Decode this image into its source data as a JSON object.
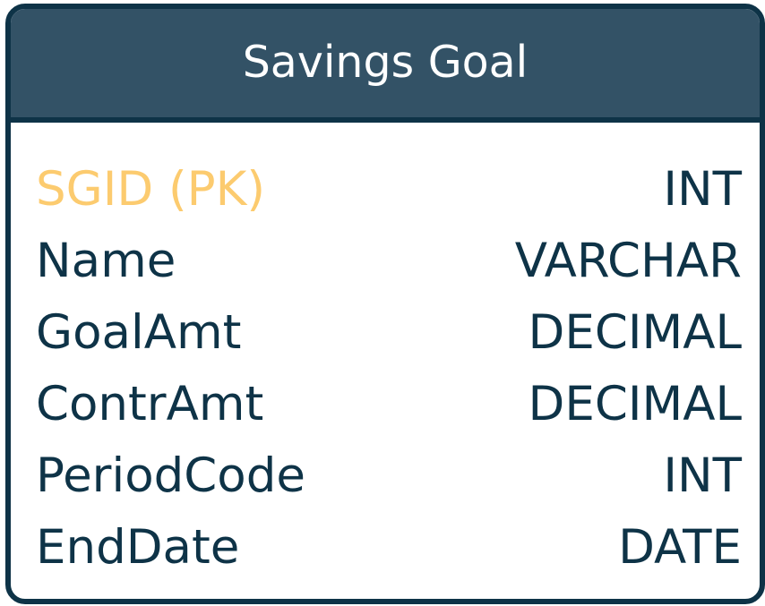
{
  "entity": {
    "title": "Savings Goal",
    "fields": [
      {
        "name": "SGID (PK)",
        "type": "INT"
      },
      {
        "name": "Name",
        "type": "VARCHAR"
      },
      {
        "name": "GoalAmt",
        "type": "DECIMAL"
      },
      {
        "name": "ContrAmt",
        "type": "DECIMAL"
      },
      {
        "name": "PeriodCode",
        "type": "INT"
      },
      {
        "name": "EndDate",
        "type": "DATE"
      }
    ]
  },
  "colors": {
    "border": "#0e3347",
    "header_background": "#335266",
    "header_text": "#ffffff",
    "primary_key_text": "#fccb6f",
    "field_text": "#0e3347"
  }
}
